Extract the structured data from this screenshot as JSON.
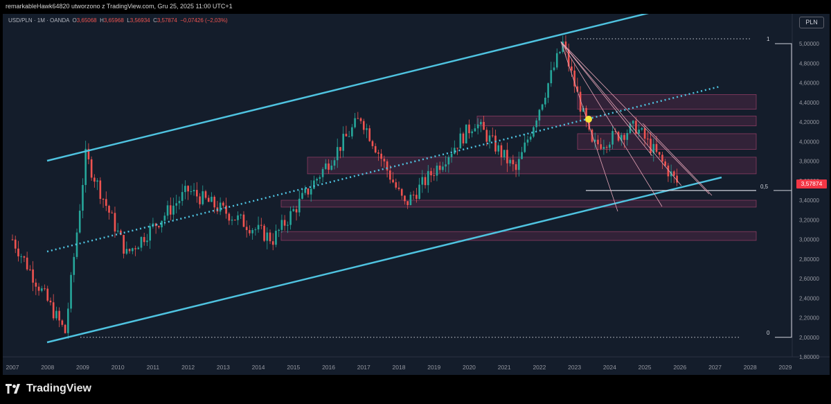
{
  "header": {
    "text": "remarkableHawk64820 utworzono z TradingView.com, Gru 25, 2025 11:00 UTC+1"
  },
  "legend": {
    "symbol": "USD/PLN · 1M · OANDA",
    "o_label": "O",
    "o_value": "3,65068",
    "h_label": "H",
    "h_value": "3,65968",
    "l_label": "L",
    "l_value": "3,56934",
    "c_label": "C",
    "c_value": "3,57874",
    "change": "−0,07426 (−2,03%)"
  },
  "currency_badge": "PLN",
  "last_price": "3,57874",
  "footer": {
    "brand": "TradingView"
  },
  "colors": {
    "background": "#141d2b",
    "up": "#26a69a",
    "down": "#ef5350",
    "channel": "#4fc3e0",
    "zone": "#6b2f4f",
    "highlight": "#f5e63a"
  },
  "chart_data": {
    "type": "candlestick",
    "symbol": "USD/PLN",
    "interval": "1M",
    "x_ticks": [
      "2007",
      "2008",
      "2009",
      "2010",
      "2011",
      "2012",
      "2013",
      "2014",
      "2015",
      "2016",
      "2017",
      "2018",
      "2019",
      "2020",
      "2021",
      "2022",
      "2023",
      "2024",
      "2025",
      "2026",
      "2027",
      "2028",
      "2029"
    ],
    "y_ticks": [
      "5,00000",
      "4,80000",
      "4,60000",
      "4,40000",
      "4,20000",
      "4,00000",
      "3,80000",
      "3,60000",
      "3,40000",
      "3,20000",
      "3,00000",
      "2,80000",
      "2,60000",
      "2,40000",
      "2,20000",
      "2,00000",
      "1,80000"
    ],
    "y_range": [
      1.8,
      5.0
    ],
    "fib_labels": [
      "1",
      "0,5",
      "0"
    ],
    "key_points": [
      {
        "date": "2007-01",
        "price": 3.0
      },
      {
        "date": "2008-07",
        "price": 2.05
      },
      {
        "date": "2009-02",
        "price": 3.85
      },
      {
        "date": "2010-04",
        "price": 2.85
      },
      {
        "date": "2012-01",
        "price": 3.5
      },
      {
        "date": "2014-06",
        "price": 3.0
      },
      {
        "date": "2016-12",
        "price": 4.25
      },
      {
        "date": "2018-03",
        "price": 3.35
      },
      {
        "date": "2020-03",
        "price": 4.2
      },
      {
        "date": "2021-05",
        "price": 3.7
      },
      {
        "date": "2022-09",
        "price": 5.0
      },
      {
        "date": "2023-07",
        "price": 3.95
      },
      {
        "date": "2024-10",
        "price": 4.15
      },
      {
        "date": "2025-12",
        "price": 3.58
      }
    ]
  }
}
